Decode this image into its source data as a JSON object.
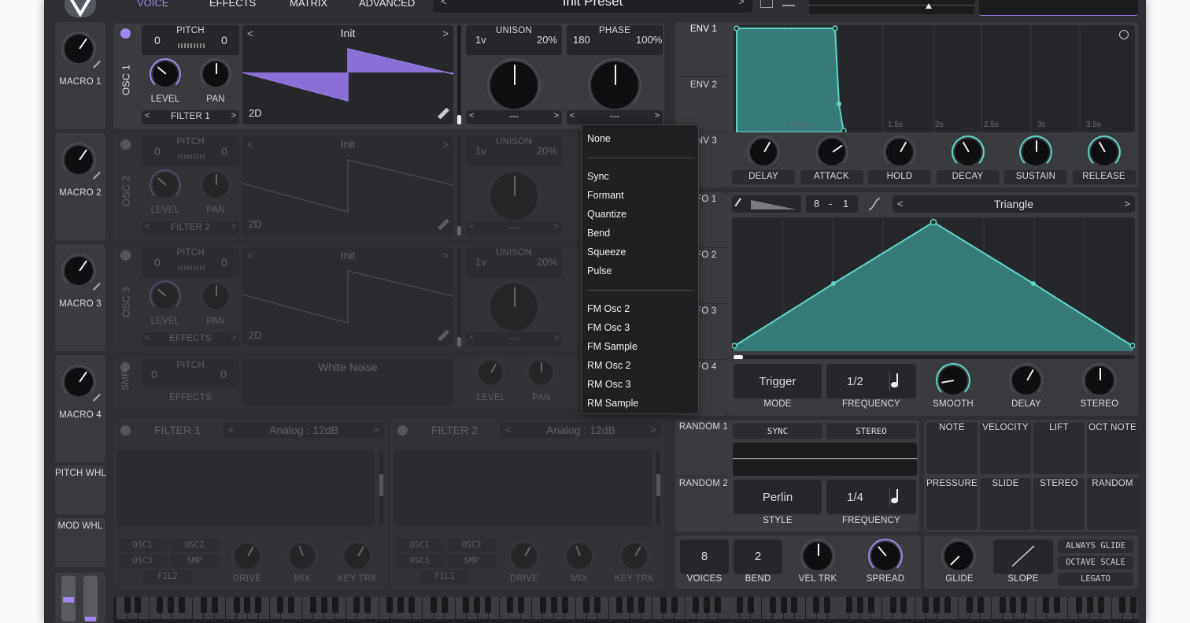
{
  "header": {
    "tabs": [
      "VOICE",
      "EFFECTS",
      "MATRIX",
      "ADVANCED"
    ],
    "preset_name": "Init Preset"
  },
  "macros": [
    "MACRO 1",
    "MACRO 2",
    "MACRO 3",
    "MACRO 4"
  ],
  "wheels": [
    "PITCH WHL",
    "MOD WHL"
  ],
  "oscillators": [
    {
      "label": "OSC 1",
      "pitch_label": "PITCH",
      "pitch_left": "0",
      "pitch_right": "0",
      "level_label": "LEVEL",
      "pan_label": "PAN",
      "route": "FILTER 1",
      "wave_name": "Init",
      "mode": "2D",
      "unison_voices": "1v",
      "unison_label": "UNISON",
      "unison_amount": "20%",
      "phase_value": "180",
      "phase_label": "PHASE",
      "phase_amount": "100%",
      "sel_left": "---",
      "sel_right": "---"
    },
    {
      "label": "OSC 2",
      "pitch_label": "PITCH",
      "pitch_left": "0",
      "pitch_right": "0",
      "level_label": "LEVEL",
      "pan_label": "PAN",
      "route": "FILTER 2",
      "wave_name": "Init",
      "mode": "2D",
      "unison_voices": "1v",
      "unison_label": "UNISON",
      "unison_amount": "20%",
      "sel_left": "---"
    },
    {
      "label": "OSC 3",
      "pitch_label": "PITCH",
      "pitch_left": "0",
      "pitch_right": "0",
      "level_label": "LEVEL",
      "pan_label": "PAN",
      "route": "EFFECTS",
      "wave_name": "Init",
      "mode": "2D",
      "unison_voices": "1v",
      "unison_label": "UNISON",
      "unison_amount": "20%",
      "sel_left": "---"
    }
  ],
  "sample": {
    "label": "SMP",
    "pitch_label": "PITCH",
    "pitch_left": "0",
    "pitch_right": "0",
    "route": "EFFECTS",
    "name": "White Noise",
    "level_label": "LEVEL",
    "pan_label": "PAN"
  },
  "dropdown": {
    "items": [
      "None",
      "Sync",
      "Formant",
      "Quantize",
      "Bend",
      "Squeeze",
      "Pulse",
      "FM Osc 2",
      "FM Osc 3",
      "FM Sample",
      "RM Osc 2",
      "RM Osc 3",
      "RM Sample"
    ]
  },
  "filters": [
    {
      "label": "FILTER 1",
      "model": "Analog : 12dB",
      "srcs": [
        "OSC1",
        "OSC2",
        "OSC3",
        "SMP",
        "FIL2"
      ],
      "knobs": [
        "DRIVE",
        "MIX",
        "KEY TRK"
      ]
    },
    {
      "label": "FILTER 2",
      "model": "Analog : 12dB",
      "srcs": [
        "OSC1",
        "OSC2",
        "OSC3",
        "SMP",
        "FIL1"
      ],
      "knobs": [
        "DRIVE",
        "MIX",
        "KEY TRK"
      ]
    }
  ],
  "env": {
    "tabs": [
      "ENV 1",
      "ENV 2",
      "ENV 3"
    ],
    "time_labels": [
      "500ms",
      "1.5s",
      "2s",
      "2.5s",
      "3s",
      "3.5s"
    ],
    "knobs": [
      "DELAY",
      "ATTACK",
      "HOLD",
      "DECAY",
      "SUSTAIN",
      "RELEASE"
    ]
  },
  "lfo": {
    "tabs": [
      "LFO 1",
      "LFO 2",
      "LFO 3",
      "LFO 4"
    ],
    "grid_left": "8",
    "grid_sep": "-",
    "grid_right": "1",
    "shape": "Triangle",
    "mode_value": "Trigger",
    "mode_label": "MODE",
    "freq_value": "1/2",
    "freq_label": "FREQUENCY",
    "knobs": [
      "SMOOTH",
      "DELAY",
      "STEREO"
    ]
  },
  "random": {
    "tabs": [
      "RANDOM 1",
      "RANDOM 2"
    ],
    "sync": "SYNC",
    "stereo": "STEREO",
    "style_value": "Perlin",
    "style_label": "STYLE",
    "freq_value": "1/4",
    "freq_label": "FREQUENCY"
  },
  "mod_sources": [
    "NOTE",
    "VELOCITY",
    "LIFT",
    "OCT NOTE",
    "PRESSURE",
    "SLIDE",
    "STEREO",
    "RANDOM"
  ],
  "voice": {
    "voices_value": "8",
    "voices_label": "VOICES",
    "bend_value": "2",
    "bend_label": "BEND",
    "veltrk_label": "VEL TRK",
    "spread_label": "SPREAD"
  },
  "glide": {
    "glide_label": "GLIDE",
    "slope_label": "SLOPE",
    "always_glide": "ALWAYS GLIDE",
    "octave_scale": "OCTAVE SCALE",
    "legato": "LEGATO"
  },
  "colors": {
    "accent_purple": "#a186f0",
    "accent_teal": "#5fd7c5",
    "panel": "#3a3b3f",
    "background": "#2e2f32"
  }
}
